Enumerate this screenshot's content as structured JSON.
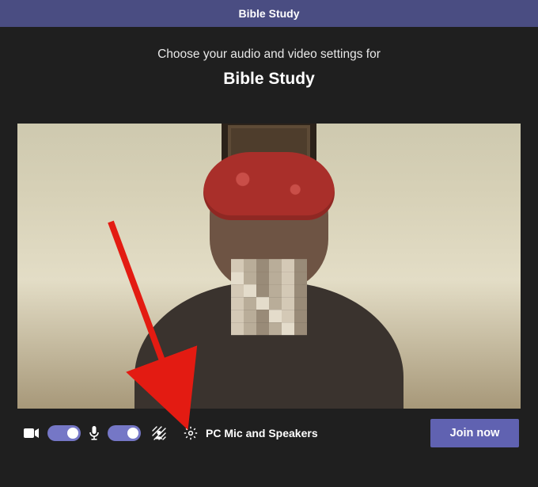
{
  "titlebar": {
    "title": "Bible Study"
  },
  "prejoin": {
    "prompt": "Choose your audio and video settings for",
    "meeting_name": "Bible Study"
  },
  "controls": {
    "camera_on": true,
    "mic_on": true,
    "device_label": "PC Mic and Speakers",
    "join_label": "Join now"
  },
  "icons": {
    "camera": "camera-icon",
    "mic": "mic-icon",
    "background_effects": "background-effects-icon",
    "settings_gear": "gear-icon"
  },
  "colors": {
    "accent": "#6062b1",
    "toggle_on": "#7577c6",
    "titlebar": "#4a4d82",
    "arrow": "#e31b12"
  }
}
